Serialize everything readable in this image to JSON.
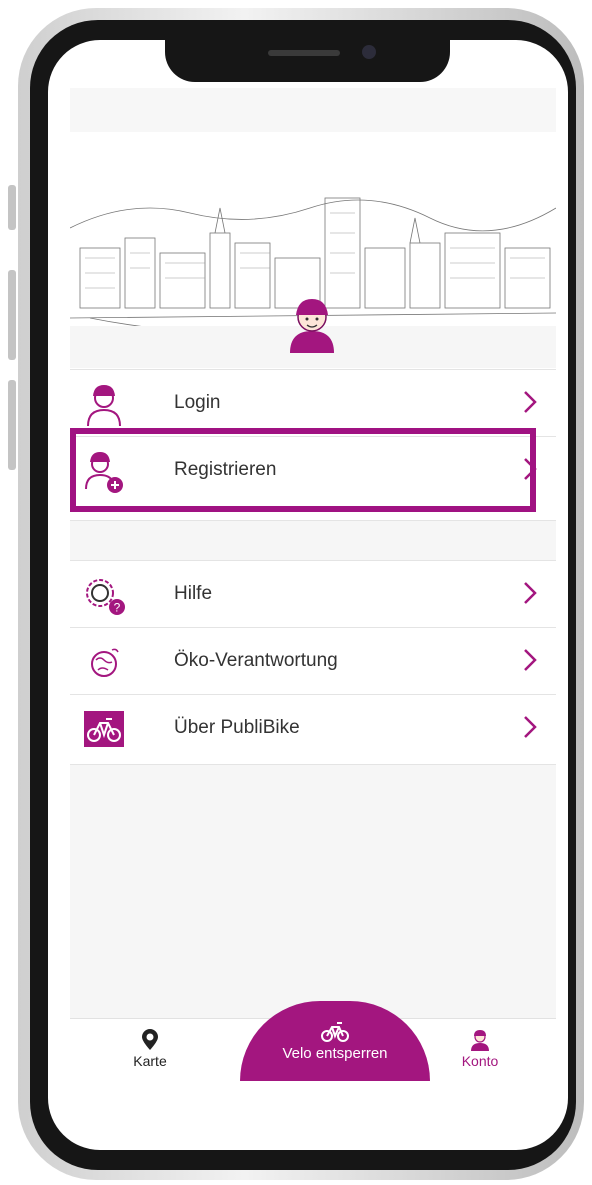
{
  "menu": {
    "section1": [
      {
        "label": "Login",
        "icon": "user-helmet-icon"
      },
      {
        "label": "Registrieren",
        "icon": "user-add-icon"
      }
    ],
    "section2": [
      {
        "label": "Hilfe",
        "icon": "gear-help-icon"
      },
      {
        "label": "Öko-Verantwortung",
        "icon": "globe-icon"
      },
      {
        "label": "Über PubliBike",
        "icon": "bike-icon"
      }
    ]
  },
  "tabbar": {
    "map_label": "Karte",
    "unlock_label": "Velo entsperren",
    "account_label": "Konto"
  },
  "colors": {
    "accent": "#a3167f",
    "highlight": "#a01282"
  }
}
